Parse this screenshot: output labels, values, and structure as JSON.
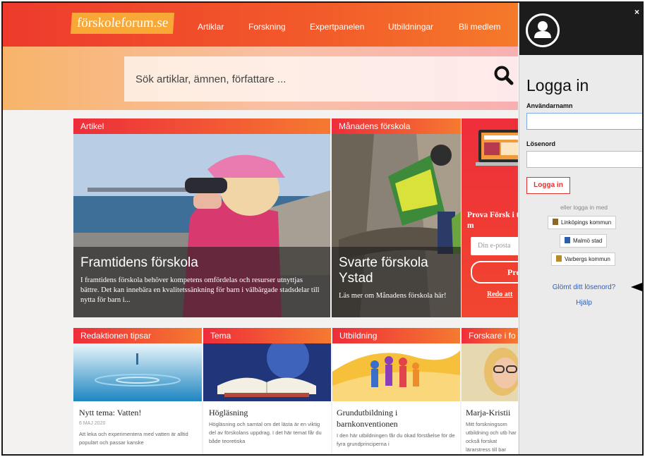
{
  "site": {
    "logo": "förskoleforum.se",
    "nav": [
      "Artiklar",
      "Forskning",
      "Expertpanelen",
      "Utbildningar",
      "Bli medlem"
    ],
    "search_placeholder": "Sök artiklar, ämnen, författare ..."
  },
  "featured": [
    {
      "category": "Artikel",
      "title": "Framtidens förskola",
      "text": "I framtidens förskola behöver kompetens omfördelas och resurser utnyttjas bättre. Det kan innebära en kvalitetssänkning för barn i välbärgade stadsdelar till nytta för barn i..."
    },
    {
      "category": "Månadens förskola",
      "title": "Svarte förskola Ystad",
      "text": "Läs mer om Månadens förskola här!"
    }
  ],
  "promo": {
    "title": "Prova Försk i två m",
    "email_placeholder": "Din e-posta",
    "button": "Pro",
    "link": "Redo att"
  },
  "cards": [
    {
      "category": "Redaktionen tipsar",
      "title": "Nytt tema: Vatten!",
      "date": "6 MAJ 2020",
      "text": "Att leka och experimentera med vatten är alltid populärt och passar kanske"
    },
    {
      "category": "Tema",
      "title": "Högläsning",
      "date": "",
      "text": "Högläsning och samtal om det lästa är en viktig del av förskolans uppdrag. I det här temat får du både teoretiska"
    },
    {
      "category": "Utbildning",
      "title": "Grundutbildning i barnkonventionen",
      "date": "",
      "text": "I den här utbildningen får du ökad förståelse för de fyra grundprinciperna i"
    },
    {
      "category": "Forskare i fo",
      "title": "Marja-Kristii",
      "date": "",
      "text": "Mitt forskningsom utbildning och utb har också forskat lärarstress till bar"
    }
  ],
  "login": {
    "close": "×",
    "title": "Logga in",
    "username_label": "Användarnamn",
    "password_label": "Lösenord",
    "button": "Logga in",
    "sso_hint": "eller logga in med",
    "sso": [
      "Linköpings kommun",
      "Malmö stad",
      "Varbergs kommun"
    ],
    "forgot": "Glömt ditt lösenord?",
    "help": "Hjälp"
  }
}
